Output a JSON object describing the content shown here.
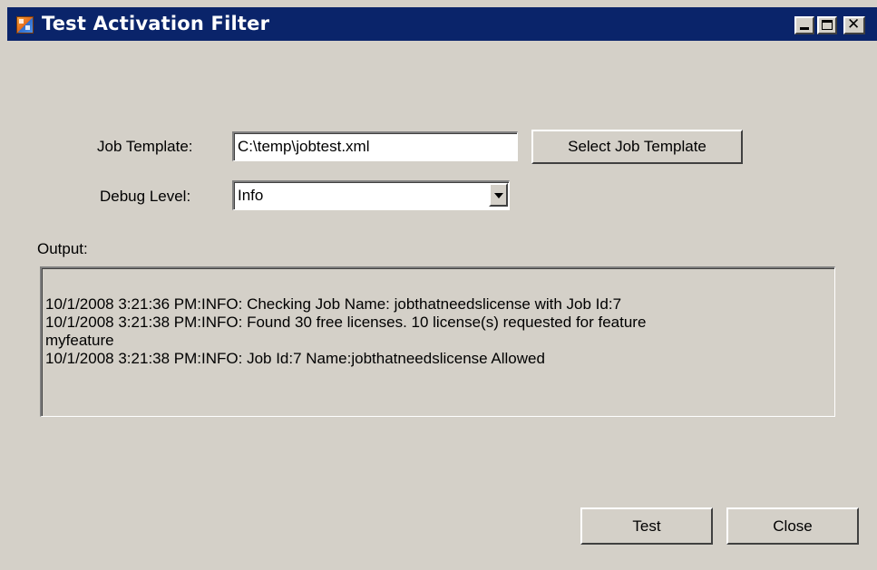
{
  "window": {
    "title": "Test Activation Filter",
    "close_glyph": "✕"
  },
  "form": {
    "job_template_label": "Job Template:",
    "job_template_value": "C:\\temp\\jobtest.xml",
    "select_button_label": "Select Job Template",
    "debug_level_label": "Debug Level:",
    "debug_level_value": "Info",
    "output_label": "Output:"
  },
  "output": {
    "lines": [
      "10/1/2008 3:21:36 PM:INFO: Checking Job Name: jobthatneedslicense with Job Id:7",
      "10/1/2008 3:21:38 PM:INFO: Found 30 free licenses. 10 license(s) requested for feature",
      "myfeature",
      "10/1/2008 3:21:38 PM:INFO: Job Id:7 Name:jobthatneedslicense Allowed"
    ]
  },
  "buttons": {
    "test_label": "Test",
    "close_label": "Close"
  },
  "colors": {
    "titlebar": "#0a246a",
    "window_bg": "#d4d0c8"
  }
}
